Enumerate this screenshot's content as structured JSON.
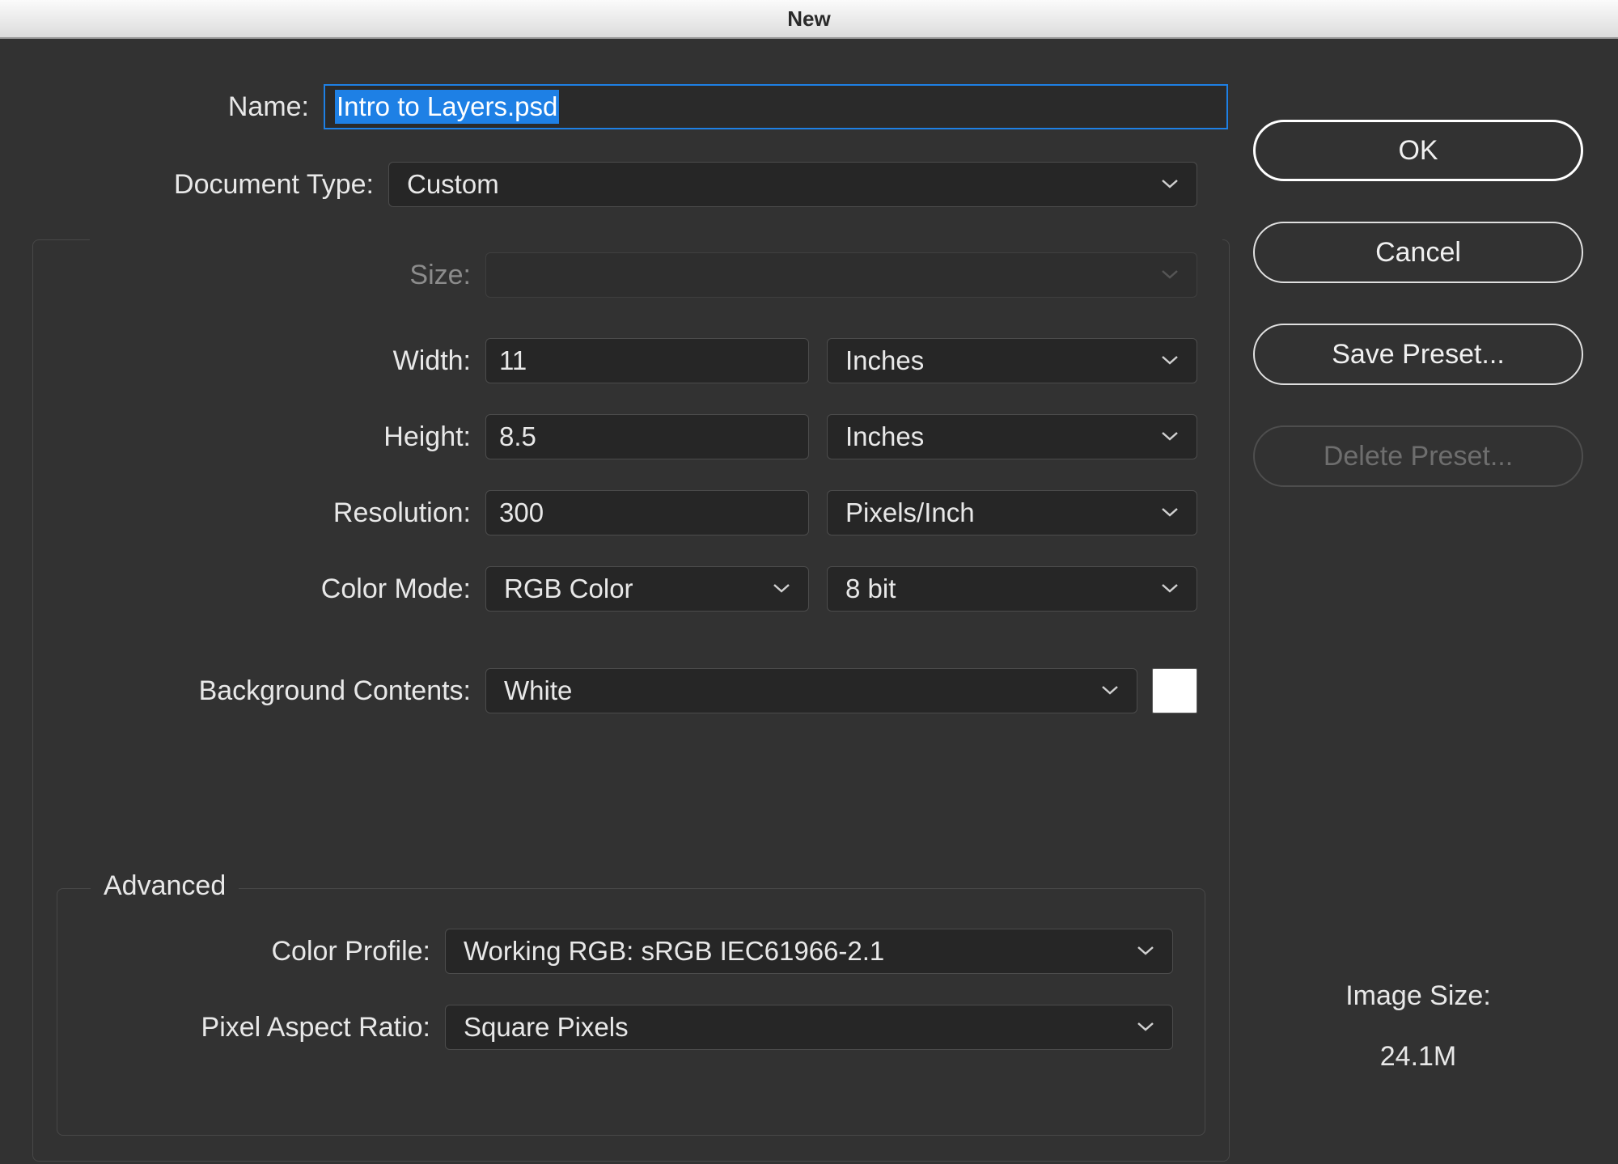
{
  "window": {
    "title": "New"
  },
  "labels": {
    "name": "Name:",
    "document_type": "Document Type:",
    "size": "Size:",
    "width": "Width:",
    "height": "Height:",
    "resolution": "Resolution:",
    "color_mode": "Color Mode:",
    "background_contents": "Background Contents:",
    "advanced": "Advanced",
    "color_profile": "Color Profile:",
    "pixel_aspect_ratio": "Pixel Aspect Ratio:",
    "image_size": "Image Size:"
  },
  "fields": {
    "name": "Intro to Layers.psd",
    "document_type": "Custom",
    "size": "",
    "width": "11",
    "width_unit": "Inches",
    "height": "8.5",
    "height_unit": "Inches",
    "resolution": "300",
    "resolution_unit": "Pixels/Inch",
    "color_mode": "RGB Color",
    "color_depth": "8 bit",
    "background_contents": "White",
    "background_swatch": "#ffffff",
    "color_profile": "Working RGB:  sRGB IEC61966-2.1",
    "pixel_aspect_ratio": "Square Pixels"
  },
  "buttons": {
    "ok": "OK",
    "cancel": "Cancel",
    "save_preset": "Save Preset...",
    "delete_preset": "Delete Preset..."
  },
  "status": {
    "image_size_value": "24.1M"
  }
}
